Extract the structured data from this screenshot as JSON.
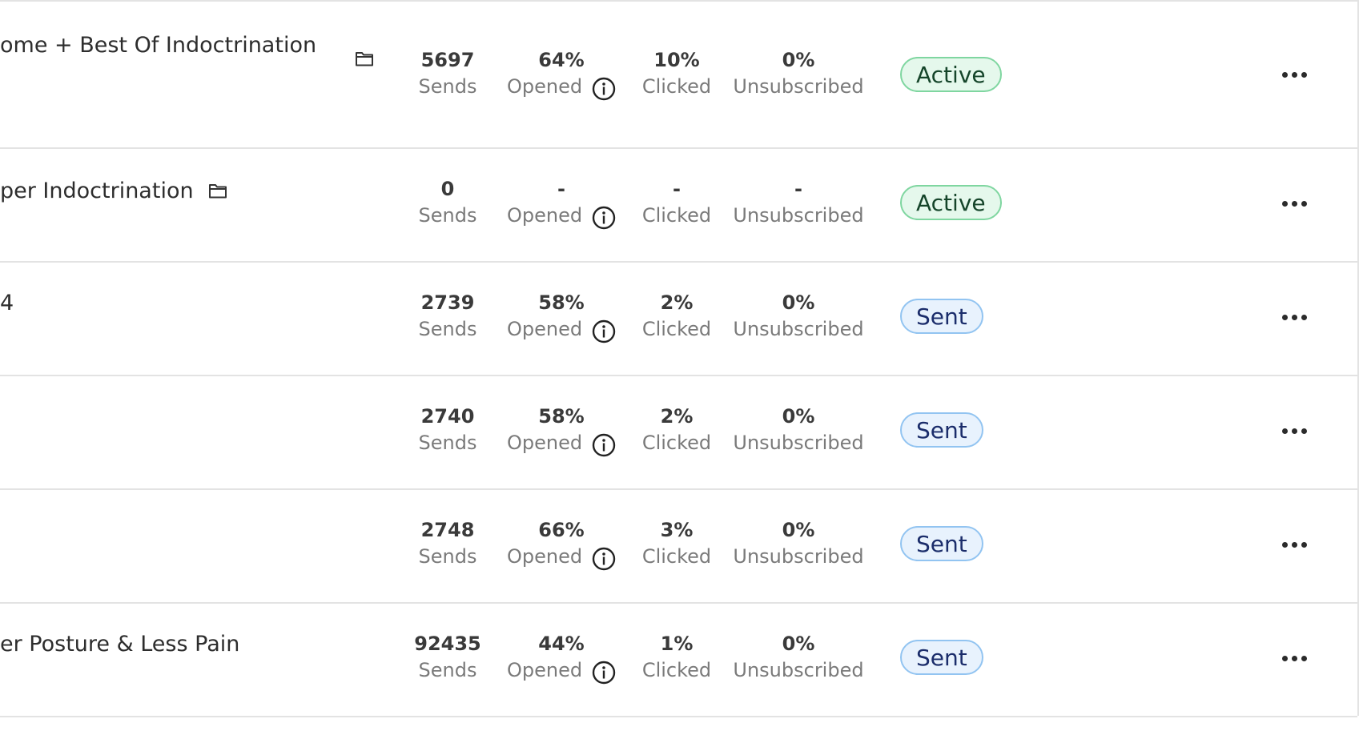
{
  "columns": {
    "sends_label": "Sends",
    "opened_label": "Opened",
    "clicked_label": "Clicked",
    "unsubscribed_label": "Unsubscribed"
  },
  "rows": [
    {
      "title": "ome + Best Of Indoctrination",
      "has_folder": true,
      "sends": "5697",
      "opened": "64%",
      "clicked": "10%",
      "unsubscribed": "0%",
      "status": "Active",
      "status_kind": "active"
    },
    {
      "title": "per Indoctrination",
      "has_folder": true,
      "sends": "0",
      "opened": "-",
      "clicked": "-",
      "unsubscribed": "-",
      "status": "Active",
      "status_kind": "active"
    },
    {
      "title": "4",
      "has_folder": false,
      "sends": "2739",
      "opened": "58%",
      "clicked": "2%",
      "unsubscribed": "0%",
      "status": "Sent",
      "status_kind": "sent"
    },
    {
      "title": "",
      "has_folder": false,
      "sends": "2740",
      "opened": "58%",
      "clicked": "2%",
      "unsubscribed": "0%",
      "status": "Sent",
      "status_kind": "sent"
    },
    {
      "title": "",
      "has_folder": false,
      "sends": "2748",
      "opened": "66%",
      "clicked": "3%",
      "unsubscribed": "0%",
      "status": "Sent",
      "status_kind": "sent"
    },
    {
      "title": "er Posture & Less Pain",
      "has_folder": false,
      "sends": "92435",
      "opened": "44%",
      "clicked": "1%",
      "unsubscribed": "0%",
      "status": "Sent",
      "status_kind": "sent"
    }
  ],
  "icons": {
    "folder": "folder-icon",
    "info": "info-icon",
    "more": "more-options-icon"
  },
  "colors": {
    "active_bg": "#e5f8ec",
    "active_border": "#7fd6a0",
    "sent_bg": "#e8f2fd",
    "sent_border": "#92c4f1",
    "divider": "#e3e3e3"
  }
}
